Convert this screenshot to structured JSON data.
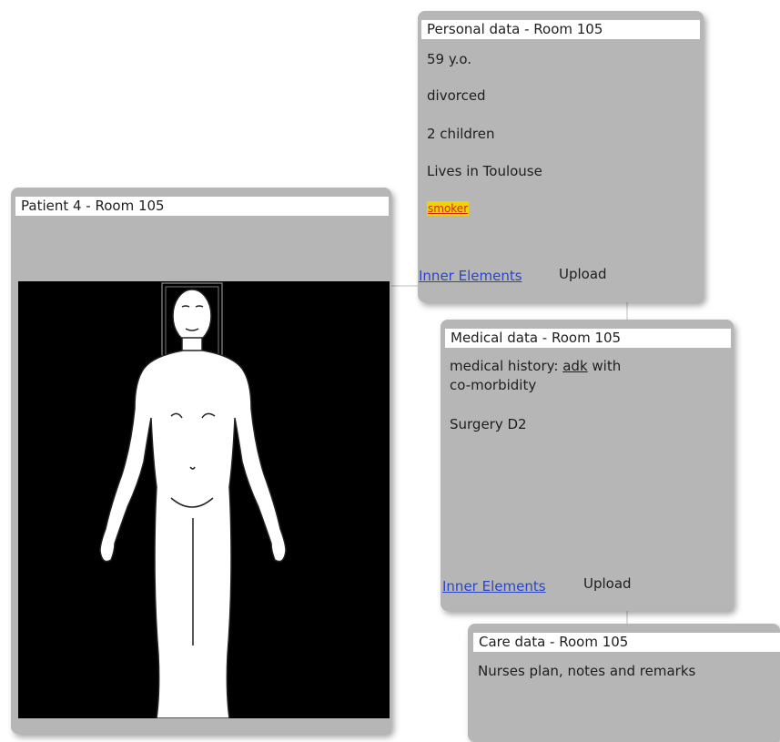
{
  "personal": {
    "title": "Personal data - Room 105",
    "lines": [
      "59 y.o.",
      "divorced",
      "2 children",
      "Lives in Toulouse"
    ],
    "tag": "smoker",
    "inner_label": "Inner Elements",
    "upload_label": "Upload"
  },
  "patient": {
    "title": "Patient 4 - Room 105"
  },
  "medical": {
    "title": "Medical data - Room 105",
    "history_prefix": "medical history: ",
    "history_abbr": "adk",
    "history_suffix": " with",
    "history_line2": "co-morbidity",
    "surgery": "Surgery D2",
    "inner_label": "Inner Elements",
    "upload_label": "Upload"
  },
  "care": {
    "title": "Care data - Room 105",
    "notes": "Nurses plan, notes and remarks"
  },
  "colors": {
    "card_bg": "#b6b6b6",
    "link": "#2a45c6",
    "tag_bg": "#f0d400",
    "tag_text": "#d12a1a"
  }
}
